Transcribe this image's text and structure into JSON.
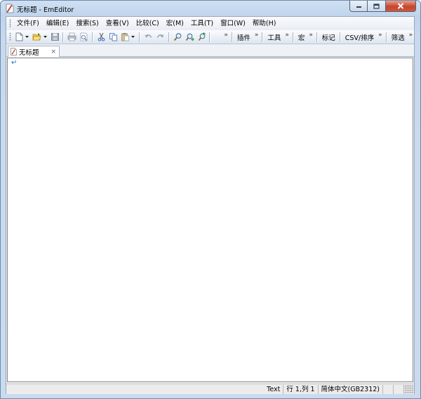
{
  "window": {
    "title": "无标题 - EmEditor"
  },
  "menubar": {
    "items": [
      {
        "label": "文件(F)"
      },
      {
        "label": "编辑(E)"
      },
      {
        "label": "搜索(S)"
      },
      {
        "label": "查看(V)"
      },
      {
        "label": "比较(C)"
      },
      {
        "label": "宏(M)"
      },
      {
        "label": "工具(T)"
      },
      {
        "label": "窗口(W)"
      },
      {
        "label": "帮助(H)"
      }
    ]
  },
  "toolbar": {
    "chevron": "»",
    "groups": [
      {
        "label": "插件"
      },
      {
        "label": "工具"
      },
      {
        "label": "宏"
      },
      {
        "label": "标记"
      },
      {
        "label": "CSV/排序"
      },
      {
        "label": "筛选"
      }
    ],
    "icons": [
      "new-document-icon",
      "open-folder-icon",
      "save-icon",
      "print-icon",
      "print-preview-icon",
      "cut-icon",
      "copy-icon",
      "paste-icon",
      "undo-icon",
      "redo-icon",
      "find-icon",
      "find-next-icon",
      "find-previous-icon"
    ]
  },
  "tabs": [
    {
      "label": "无标题",
      "close": "×"
    }
  ],
  "editor": {
    "eol_mark": "↵"
  },
  "statusbar": {
    "mode": "Text",
    "position": "行 1,列 1",
    "encoding": "简体中文(GB2312)"
  },
  "colors": {
    "frame": "#c4d6ec",
    "close_button": "#c7462c",
    "eol_mark": "#1e63c8"
  }
}
